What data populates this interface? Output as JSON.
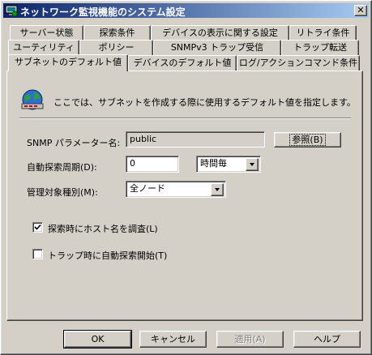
{
  "window": {
    "title": "ネットワーク監視機能のシステム設定",
    "close_glyph": "✕"
  },
  "tabs": {
    "row1": [
      "サーバー状態",
      "探索条件",
      "デバイスの表示に関する設定",
      "リトライ条件"
    ],
    "row2": [
      "ユーティリティ",
      "ポリシー",
      "SNMPv3 トラップ受信",
      "トラップ転送"
    ],
    "row3": [
      "サブネットのデフォルト値",
      "デバイスのデフォルト値",
      "ログ/アクションコマンド条件"
    ],
    "selected": "サブネットのデフォルト値"
  },
  "panel": {
    "description": "ここでは、サブネットを作成する際に使用するデフォルト値を指定します。",
    "snmp": {
      "label": "SNMP パラメーター名:",
      "value": "public",
      "browse_button": "参照(B)"
    },
    "discovery_interval": {
      "label": "自動探索周期(D):",
      "value": "0",
      "unit_selected": "時間毎"
    },
    "managed_type": {
      "label": "管理対象種別(M):",
      "selected": "全ノード"
    },
    "checkbox_hostname": {
      "label": "探索時にホスト名を調査(L)",
      "checked": true
    },
    "checkbox_trap": {
      "label": "トラップ時に自動探索開始(T)",
      "checked": false
    }
  },
  "buttons": {
    "ok": "OK",
    "cancel": "キャンセル",
    "apply": "適用(A)",
    "help": "ヘルプ"
  }
}
